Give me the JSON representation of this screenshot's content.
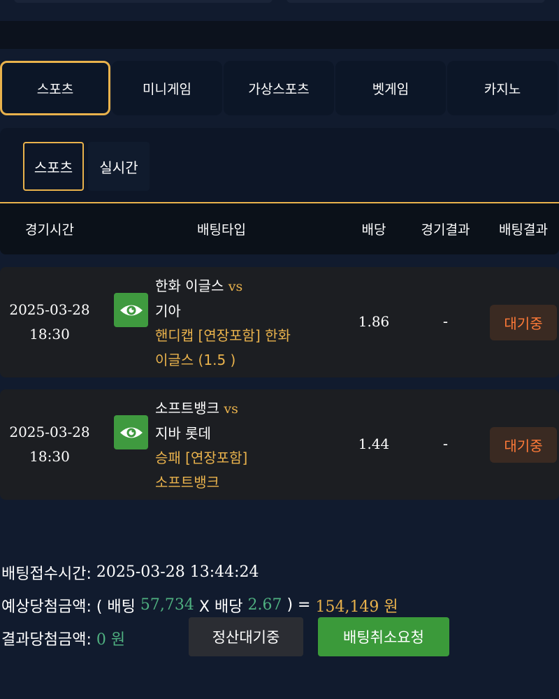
{
  "main_tabs": [
    "스포츠",
    "미니게임",
    "가상스포츠",
    "벳게임",
    "카지노"
  ],
  "sub_tabs": [
    "스포츠",
    "실시간"
  ],
  "table_headers": {
    "time": "경기시간",
    "bet_type": "배팅타입",
    "odds": "배당",
    "game_result": "경기결과",
    "bet_result": "배팅결과"
  },
  "bets": [
    {
      "date": "2025-03-28",
      "time": "18:30",
      "home": "한화 이글스",
      "vs": "vs",
      "away": "기아",
      "pick_line1": "핸디캡 [연장포함] 한화",
      "pick_line2": "이글스 (1.5 )",
      "odds": "1.86",
      "result": "-",
      "status": "대기중"
    },
    {
      "date": "2025-03-28",
      "time": "18:30",
      "home": "소프트뱅크",
      "vs": "vs",
      "away": "지바 롯데",
      "pick_line1": "승패 [연장포함]",
      "pick_line2": "소프트뱅크",
      "odds": "1.44",
      "result": "-",
      "status": "대기중"
    }
  ],
  "summary": {
    "received_label": "배팅접수시간:",
    "received_value": "2025-03-28 13:44:24",
    "expected_label": "예상당첨금액:",
    "open_paren": "( 배팅",
    "stake": "57,734",
    "times": "X 배당",
    "total_odds": "2.67",
    "close_eq": ") =",
    "expected_amount": "154,149 원",
    "result_label": "결과당첨금액:",
    "result_amount": "0 원"
  },
  "buttons": {
    "pending": "정산대기중",
    "cancel": "배팅취소요청"
  },
  "colors": {
    "background": "#111b2e",
    "accent_gold": "#e9b24c",
    "green_amount": "#4fb080",
    "status_orange": "#ff7a38",
    "cancel_green": "#3b9a3a",
    "eye_green": "#3f9a3f"
  }
}
